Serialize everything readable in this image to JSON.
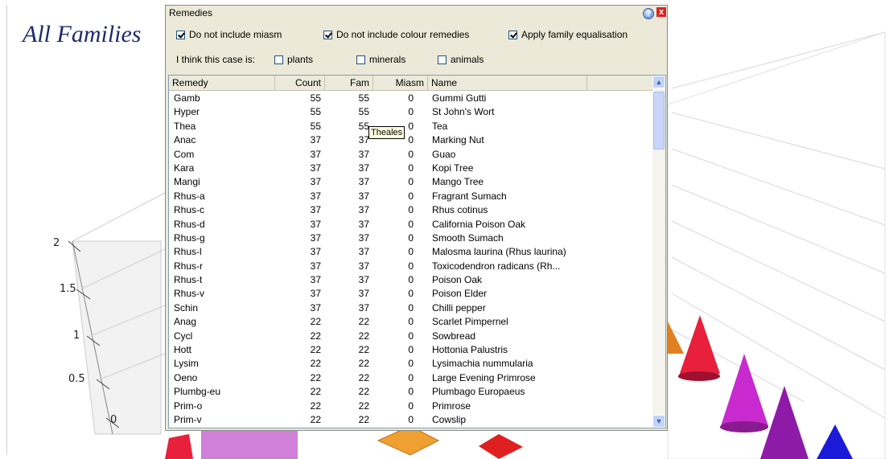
{
  "chart": {
    "title": "All Families",
    "y_ticks": [
      "2",
      "1.5",
      "1",
      "0.5",
      "0"
    ]
  },
  "dialog": {
    "title": "Remedies",
    "help_symbol": "?",
    "close_symbol": "x",
    "options": [
      {
        "label": "Do not include miasm",
        "checked": true
      },
      {
        "label": "Do not include colour remedies",
        "checked": true
      },
      {
        "label": "Apply family equalisation",
        "checked": true
      }
    ],
    "case_label": "I think this case is:",
    "case_options": [
      {
        "label": "plants",
        "checked": false
      },
      {
        "label": "minerals",
        "checked": false
      },
      {
        "label": "animals",
        "checked": false
      }
    ],
    "columns": [
      "Remedy",
      "Count",
      "Fam",
      "Miasm",
      "Name"
    ],
    "rows": [
      [
        "Gamb",
        "55",
        "55",
        "0",
        "Gummi Gutti"
      ],
      [
        "Hyper",
        "55",
        "55",
        "0",
        "St John's Wort"
      ],
      [
        "Thea",
        "55",
        "55",
        "0",
        "Tea"
      ],
      [
        "Anac",
        "37",
        "37",
        "0",
        "Marking Nut"
      ],
      [
        "Com",
        "37",
        "37",
        "0",
        "Guao"
      ],
      [
        "Kara",
        "37",
        "37",
        "0",
        "Kopi Tree"
      ],
      [
        "Mangi",
        "37",
        "37",
        "0",
        "Mango Tree"
      ],
      [
        "Rhus-a",
        "37",
        "37",
        "0",
        "Fragrant Sumach"
      ],
      [
        "Rhus-c",
        "37",
        "37",
        "0",
        "Rhus cotinus"
      ],
      [
        "Rhus-d",
        "37",
        "37",
        "0",
        "California Poison Oak"
      ],
      [
        "Rhus-g",
        "37",
        "37",
        "0",
        "Smooth Sumach"
      ],
      [
        "Rhus-l",
        "37",
        "37",
        "0",
        "Malosma laurina (Rhus laurina)"
      ],
      [
        "Rhus-r",
        "37",
        "37",
        "0",
        "Toxicodendron radicans  (Rh..."
      ],
      [
        "Rhus-t",
        "37",
        "37",
        "0",
        "Poison Oak"
      ],
      [
        "Rhus-v",
        "37",
        "37",
        "0",
        "Poison Elder"
      ],
      [
        "Schin",
        "37",
        "37",
        "0",
        "Chilli pepper"
      ],
      [
        "Anag",
        "22",
        "22",
        "0",
        "Scarlet Pimpernel"
      ],
      [
        "Cycl",
        "22",
        "22",
        "0",
        "Sowbread"
      ],
      [
        "Hott",
        "22",
        "22",
        "0",
        "Hottonia Palustris"
      ],
      [
        "Lysim",
        "22",
        "22",
        "0",
        "Lysimachia nummularia"
      ],
      [
        "Oeno",
        "22",
        "22",
        "0",
        "Large Evening Primrose"
      ],
      [
        "Plumbg-eu",
        "22",
        "22",
        "0",
        "Plumbago Europaeus"
      ],
      [
        "Prim-o",
        "22",
        "22",
        "0",
        "Primrose"
      ],
      [
        "Prim-v",
        "22",
        "22",
        "0",
        "Cowslip"
      ]
    ],
    "tooltip": "Theales",
    "scroll_up_icon": "▲",
    "scroll_down_icon": "▼"
  },
  "colors": {
    "dialog_bg": "#ece9d8",
    "title_color": "#1c2a6e",
    "cone_red": "#e8203c",
    "cone_magenta": "#c82ad0",
    "cone_blue": "#1a1ad8",
    "bar_pink": "#d080d8",
    "diamond_orange": "#f0a030"
  }
}
